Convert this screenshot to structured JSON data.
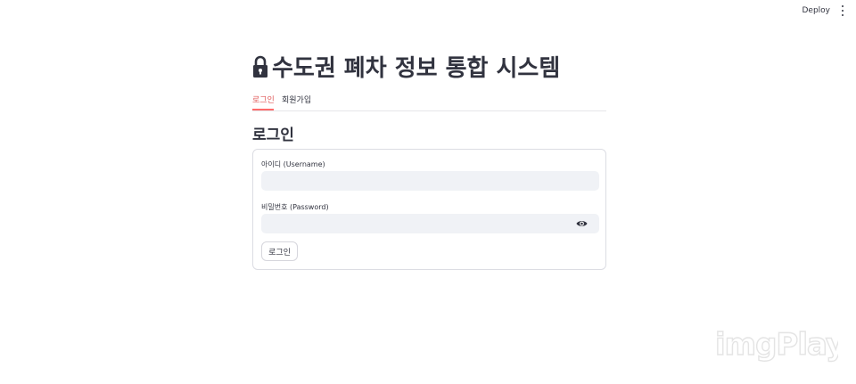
{
  "header": {
    "deploy_label": "Deploy",
    "menu_icon": "more-vertical-icon"
  },
  "page": {
    "title": "수도권 폐차 정보 통합 시스템",
    "title_icon": "lock-icon"
  },
  "tabs": [
    {
      "label": "로그인",
      "active": true
    },
    {
      "label": "회원가입",
      "active": false
    }
  ],
  "login_form": {
    "heading": "로그인",
    "username_label": "아이디 (Username)",
    "username_value": "",
    "password_label": "비밀번호 (Password)",
    "password_value": "",
    "password_toggle_icon": "eye-icon",
    "submit_label": "로그인"
  },
  "watermark": {
    "text": "imgPlay"
  },
  "colors": {
    "accent": "#ff4b4b",
    "text": "#31333f",
    "input_bg": "#f0f2f6",
    "border": "#dcdde3"
  }
}
